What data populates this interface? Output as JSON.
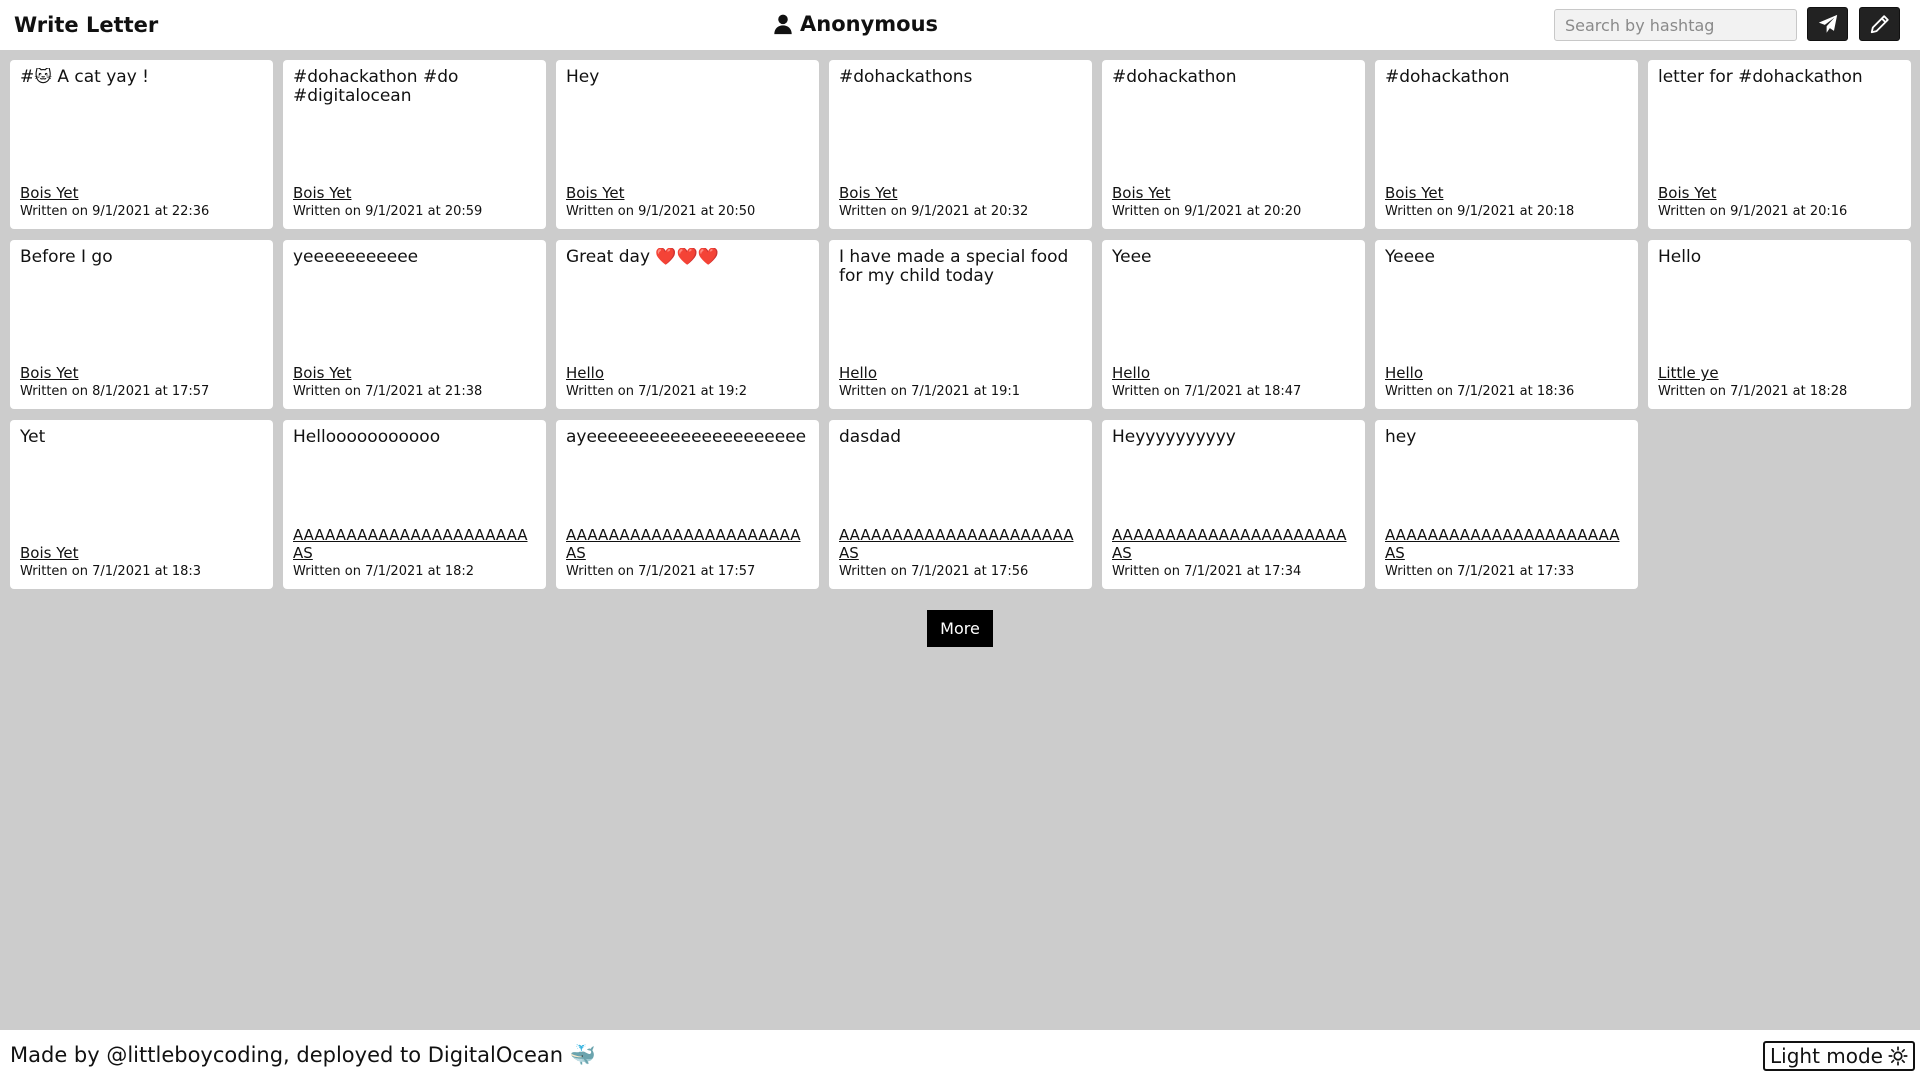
{
  "header": {
    "brand": "Write Letter",
    "user_name": "Anonymous",
    "user_icon": "user-icon",
    "search_placeholder": "Search by hashtag",
    "send_icon": "paper-plane-icon",
    "write_icon": "pencil-icon"
  },
  "letters": [
    {
      "text": "#🐱 A cat yay !",
      "author": "Bois Yet",
      "date": "Written on 9/1/2021 at 22:36"
    },
    {
      "text": "#dohackathon #do #digitalocean",
      "author": "Bois Yet",
      "date": "Written on 9/1/2021 at 20:59"
    },
    {
      "text": "Hey",
      "author": "Bois Yet",
      "date": "Written on 9/1/2021 at 20:50"
    },
    {
      "text": "#dohackathons",
      "author": "Bois Yet",
      "date": "Written on 9/1/2021 at 20:32"
    },
    {
      "text": "#dohackathon",
      "author": "Bois Yet",
      "date": "Written on 9/1/2021 at 20:20"
    },
    {
      "text": "#dohackathon",
      "author": "Bois Yet",
      "date": "Written on 9/1/2021 at 20:18"
    },
    {
      "text": "letter for #dohackathon",
      "author": "Bois Yet",
      "date": "Written on 9/1/2021 at 20:16"
    },
    {
      "text": "Before I go",
      "author": "Bois Yet",
      "date": "Written on 8/1/2021 at 17:57"
    },
    {
      "text": "yeeeeeeeeeee",
      "author": "Bois Yet",
      "date": "Written on 7/1/2021 at 21:38"
    },
    {
      "text": "Great day ❤️❤️❤️",
      "author": "Hello",
      "date": "Written on 7/1/2021 at 19:2"
    },
    {
      "text": "I have made a special food for my child today",
      "author": "Hello",
      "date": "Written on 7/1/2021 at 19:1"
    },
    {
      "text": "Yeee",
      "author": "Hello",
      "date": "Written on 7/1/2021 at 18:47"
    },
    {
      "text": "Yeeee",
      "author": "Hello",
      "date": "Written on 7/1/2021 at 18:36"
    },
    {
      "text": "Hello",
      "author": "Little ye",
      "date": "Written on 7/1/2021 at 18:28"
    },
    {
      "text": "Yet",
      "author": "Bois Yet",
      "date": "Written on 7/1/2021 at 18:3"
    },
    {
      "text": "Hellooooooooooo",
      "author": "AAAAAAAAAAAAAAAAAAAAAAAS",
      "date": "Written on 7/1/2021 at 18:2"
    },
    {
      "text": "ayeeeeeeeeeeeeeeeeeeeee",
      "author": "AAAAAAAAAAAAAAAAAAAAAAAS",
      "date": "Written on 7/1/2021 at 17:57"
    },
    {
      "text": "dasdad",
      "author": "AAAAAAAAAAAAAAAAAAAAAAAS",
      "date": "Written on 7/1/2021 at 17:56"
    },
    {
      "text": "Heyyyyyyyyyy",
      "author": "AAAAAAAAAAAAAAAAAAAAAAAS",
      "date": "Written on 7/1/2021 at 17:34"
    },
    {
      "text": "hey",
      "author": "AAAAAAAAAAAAAAAAAAAAAAAS",
      "date": "Written on 7/1/2021 at 17:33"
    }
  ],
  "more_label": "More",
  "footer": {
    "credit": "Made by @littleboycoding, deployed to DigitalOcean 🐳",
    "mode_label": "Light mode",
    "mode_icon": "sun-icon"
  }
}
